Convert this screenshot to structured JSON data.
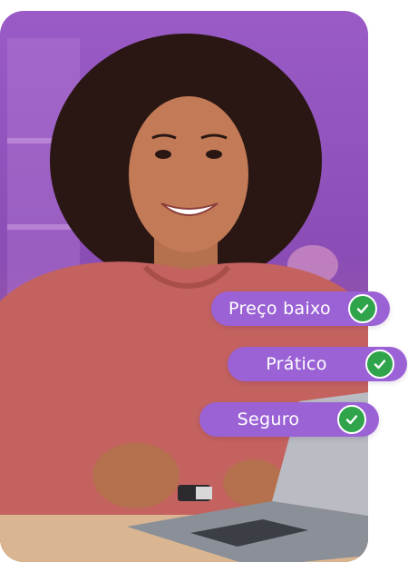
{
  "features": [
    {
      "label": "Preço baixo",
      "icon": "check-icon"
    },
    {
      "label": "Prático",
      "icon": "check-icon"
    },
    {
      "label": "Seguro",
      "icon": "check-icon"
    }
  ],
  "colors": {
    "pill_background": "#9b62d6",
    "check_background": "#2fa44a",
    "hero_background": "#8a4db5"
  }
}
